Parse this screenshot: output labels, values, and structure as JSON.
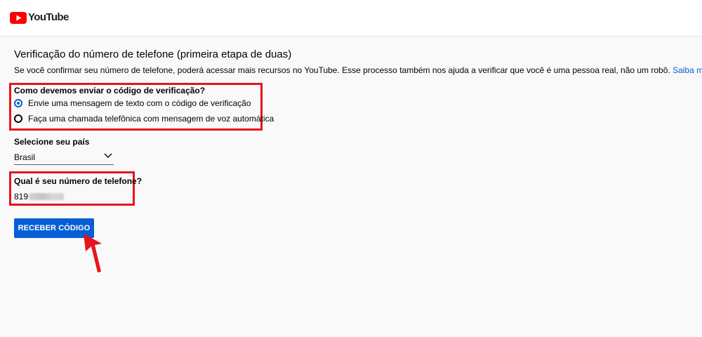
{
  "header": {
    "logo_text": "YouTube",
    "logo_color": "#ff0000"
  },
  "verification": {
    "title": "Verificação do número de telefone (primeira etapa de duas)",
    "description": "Se você confirmar seu número de telefone, poderá acessar mais recursos no YouTube. Esse processo também nos ajuda a verificar que você é uma pessoa real, não um robô.",
    "learn_more_label": "Saiba mais",
    "method_label": "Como devemos enviar o código de verificação?",
    "method_options": [
      {
        "label": "Envie uma mensagem de texto com o código de verificação",
        "selected": true
      },
      {
        "label": "Faça uma chamada telefônica com mensagem de voz automática",
        "selected": false
      }
    ],
    "country_label": "Selecione seu país",
    "country_value": "Brasil",
    "phone_label": "Qual é seu número de telefone?",
    "phone_value_visible": "819",
    "submit_label": "RECEBER CÓDIGO"
  },
  "colors": {
    "accent": "#065fd4",
    "highlight": "#e8141b",
    "background": "#f9f9f9"
  }
}
